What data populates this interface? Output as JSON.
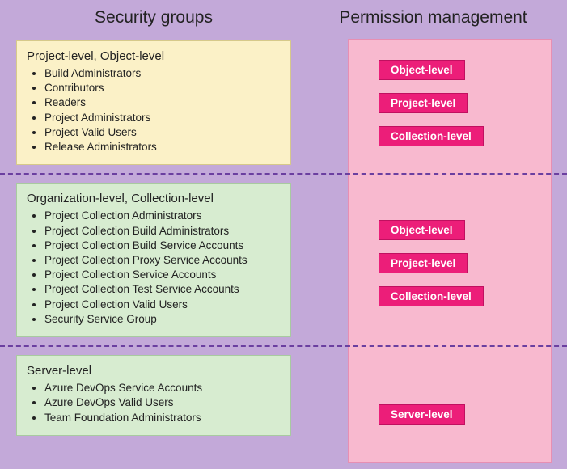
{
  "headers": {
    "left": "Security groups",
    "right": "Permission management"
  },
  "sections": [
    {
      "boxClass": "box-yellow",
      "title": "Project-level, Object-level",
      "items": [
        "Build Administrators",
        "Contributors",
        "Readers",
        "Project Administrators",
        "Project Valid Users",
        "Release Administrators"
      ],
      "perms": [
        "Object-level",
        "Project-level",
        "Collection-level"
      ]
    },
    {
      "boxClass": "box-green",
      "title": "Organization-level, Collection-level",
      "items": [
        "Project Collection Administrators",
        "Project Collection Build Administrators",
        "Project Collection Build Service Accounts",
        "Project Collection Proxy Service Accounts",
        "Project Collection Service Accounts",
        "Project Collection Test Service Accounts",
        "Project Collection Valid Users",
        "Security Service Group"
      ],
      "perms": [
        "Object-level",
        "Project-level",
        "Collection-level"
      ]
    },
    {
      "boxClass": "box-green",
      "title": "Server-level",
      "items": [
        "Azure DevOps Service Accounts",
        "Azure DevOps Valid Users",
        "Team Foundation Administrators"
      ],
      "perms": [
        "Server-level"
      ]
    }
  ],
  "permStackTops": [
    74,
    272,
    500
  ]
}
